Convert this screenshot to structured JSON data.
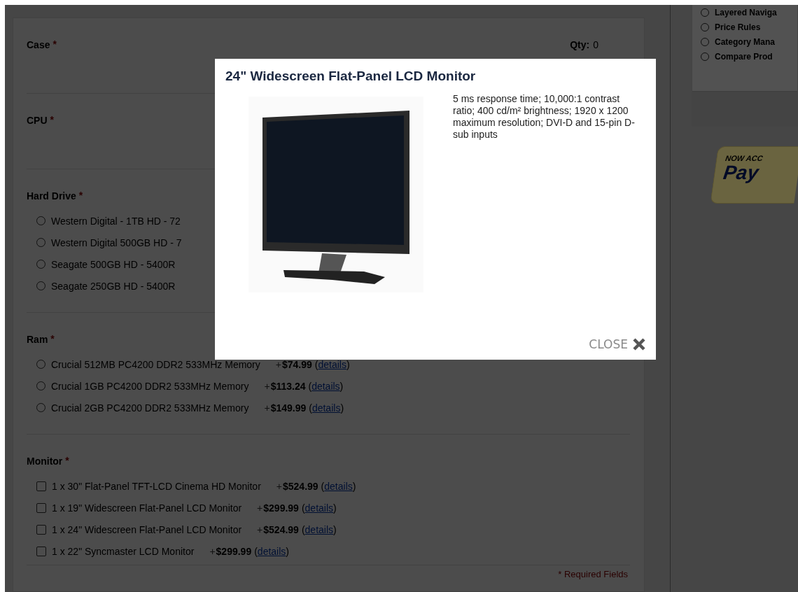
{
  "form": {
    "sections": [
      {
        "label": "Case",
        "required_mark": "*",
        "qty": {
          "label": "Qty:",
          "value": "0"
        }
      },
      {
        "label": "CPU",
        "required_mark": "*"
      },
      {
        "label": "Hard Drive",
        "required_mark": "*",
        "options": [
          {
            "kind": "radio",
            "label": "Western Digital - 1TB HD - 72",
            "checked": false
          },
          {
            "kind": "radio",
            "label": "Western Digital 500GB HD - 7",
            "checked": false
          },
          {
            "kind": "radio",
            "label": "Seagate 500GB HD - 5400R",
            "checked": false
          },
          {
            "kind": "radio",
            "label": "Seagate 250GB HD - 5400R",
            "checked": false
          }
        ]
      },
      {
        "label": "Ram",
        "required_mark": "*",
        "options": [
          {
            "kind": "radio",
            "label": "Crucial 512MB PC4200 DDR2 533MHz Memory",
            "plus": "+",
            "price": "$74.99",
            "paren_open": "(",
            "link": "details",
            "paren_close": ")",
            "checked": false
          },
          {
            "kind": "radio",
            "label": "Crucial 1GB PC4200 DDR2 533MHz Memory",
            "plus": "+",
            "price": "$113.24",
            "paren_open": "(",
            "link": "details",
            "paren_close": ")",
            "checked": false
          },
          {
            "kind": "radio",
            "label": "Crucial 2GB PC4200 DDR2 533MHz Memory",
            "plus": "+",
            "price": "$149.99",
            "paren_open": "(",
            "link": "details",
            "paren_close": ")",
            "checked": false
          }
        ]
      },
      {
        "label": "Monitor",
        "required_mark": "*",
        "options": [
          {
            "kind": "checkbox",
            "label": "1 x 30\" Flat-Panel TFT-LCD Cinema HD Monitor",
            "plus": "+",
            "price": "$524.99",
            "paren_open": "(",
            "link": "details",
            "paren_close": ")",
            "checked": false
          },
          {
            "kind": "checkbox",
            "label": "1 x 19\" Widescreen Flat-Panel LCD Monitor",
            "plus": "+",
            "price": "$299.99",
            "paren_open": "(",
            "link": "details",
            "paren_close": ")",
            "checked": false
          },
          {
            "kind": "checkbox",
            "label": "1 x 24\" Widescreen Flat-Panel LCD Monitor",
            "plus": "+",
            "price": "$524.99",
            "paren_open": "(",
            "link": "details",
            "paren_close": ")",
            "checked": false
          },
          {
            "kind": "checkbox",
            "label": "1 x 22\" Syncmaster LCD Monitor",
            "plus": "+",
            "price": "$299.99",
            "paren_open": "(",
            "link": "details",
            "paren_close": ")",
            "checked": false
          }
        ]
      }
    ],
    "required_note": "* Required Fields"
  },
  "sidebar": {
    "items": [
      {
        "label": "Layered Naviga",
        "checked": false
      },
      {
        "label": "Price Rules",
        "checked": false
      },
      {
        "label": "Category Mana",
        "checked": false
      },
      {
        "label": "Compare Prod",
        "checked": false
      }
    ]
  },
  "paypal_banner": {
    "tagline": "NOW ACC",
    "brand": "Pay"
  },
  "modal": {
    "title": "24\" Widescreen Flat-Panel LCD Monitor",
    "description": "5 ms response time; 10,000:1 contrast ratio; 400 cd/m² brightness; 1920 x 1200 maximum resolution; DVI-D and 15-pin D-sub inputs",
    "close_label": "CLOSE"
  }
}
